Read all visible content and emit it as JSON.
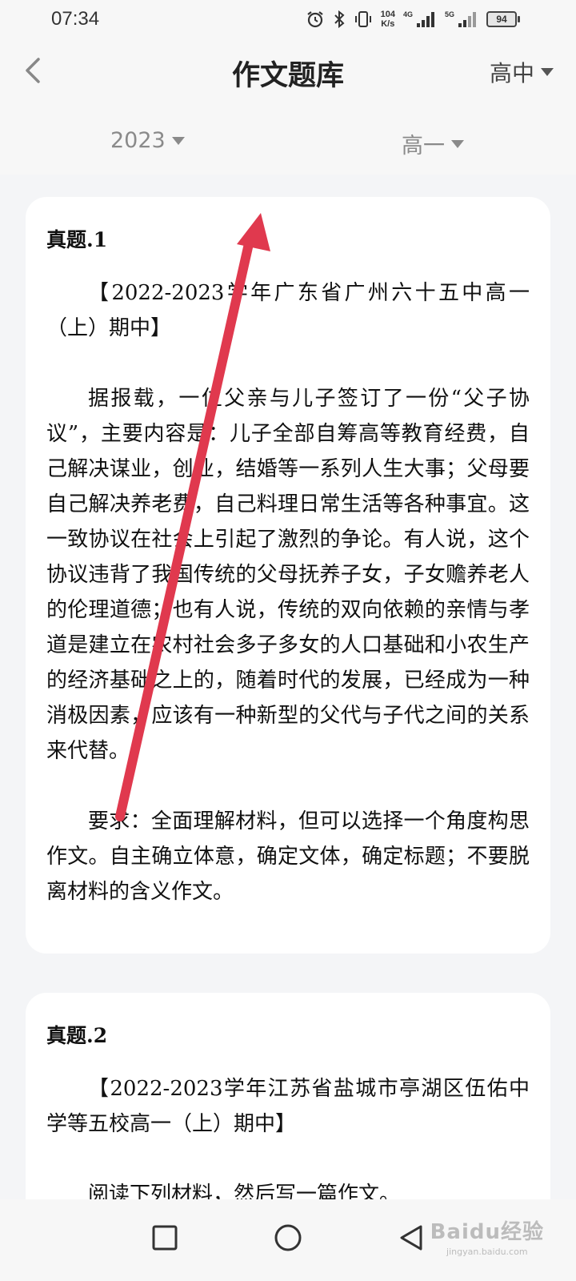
{
  "status_bar": {
    "time": "07:34",
    "net_speed_value": "104",
    "net_speed_unit": "K/s",
    "sim1_tag": "4G",
    "sim2_tag": "5G",
    "battery": "94"
  },
  "header": {
    "title": "作文题库",
    "level": "高中",
    "filters": {
      "year": "2023",
      "grade": "高一"
    }
  },
  "cards": [
    {
      "title": "真题.1",
      "source": "【2022-2023学年广东省广州六十五中高一（上）期中】",
      "body": "据报载，一位父亲与儿子签订了一份“父子协议”，主要内容是：儿子全部自筹高等教育经费，自己解决谋业，创业，结婚等一系列人生大事；父母要自己解决养老费，自己料理日常生活等各种事宜。这一致协议在社会上引起了激烈的争论。有人说，这个协议违背了我国传统的父母抚养子女，子女赡养老人的伦理道德；也有人说，传统的双向依赖的亲情与孝道是建立在农村社会多子多女的人口基础和小农生产的经济基础之上的，随着时代的发展，已经成为一种消极因素，应该有一种新型的父代与子代之间的关系来代替。",
      "requirement": "要求：全面理解材料，但可以选择一个角度构思作文。自主确立体意，确定文体，确定标题；不要脱离材料的含义作文。"
    },
    {
      "title": "真题.2",
      "source": "【2022-2023学年江苏省盐城市亭湖区伍佑中学等五校高一（上）期中】",
      "body": "阅读下列材料，然后写一篇作文。"
    }
  ],
  "watermark": {
    "brand": "Baidu经验",
    "url": "jingyan.baidu.com"
  },
  "colors": {
    "annotation_arrow": "#e0394e",
    "background": "#f4f5f7",
    "card": "#ffffff"
  }
}
